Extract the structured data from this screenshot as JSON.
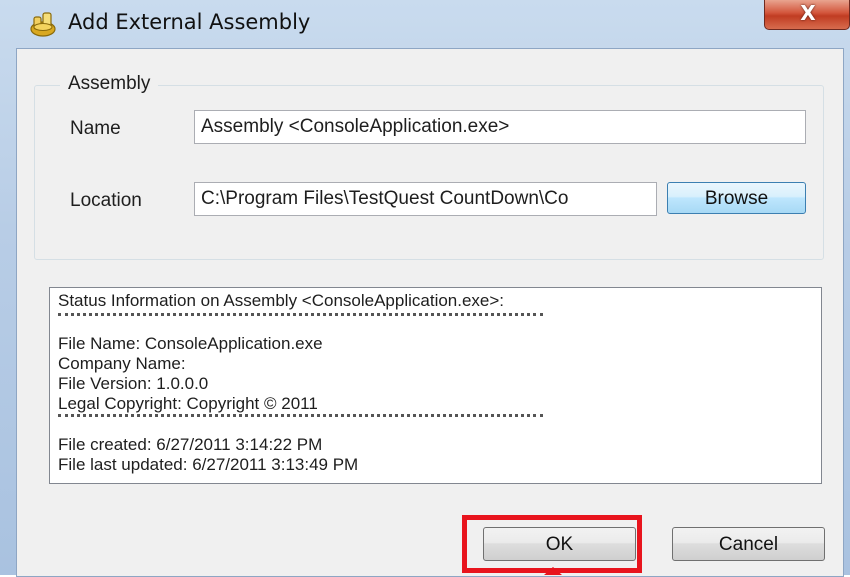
{
  "window": {
    "title": "Add External Assembly",
    "close_glyph": "X"
  },
  "assembly_group": {
    "legend": "Assembly",
    "name_label": "Name",
    "name_value": "Assembly <ConsoleApplication.exe>",
    "location_label": "Location",
    "location_value": "C:\\Program Files\\TestQuest CountDown\\Co",
    "browse_label": "Browse"
  },
  "status": {
    "heading": "Status Information on  Assembly <ConsoleApplication.exe>:",
    "file_name": "File Name: ConsoleApplication.exe",
    "company_name": "Company Name:",
    "file_version": "File Version: 1.0.0.0",
    "legal_copyright": "Legal Copyright: Copyright ©  2011",
    "file_created": "File created: 6/27/2011 3:14:22 PM",
    "file_updated": "File last updated: 6/27/2011 3:13:49 PM"
  },
  "buttons": {
    "ok_label": "OK",
    "cancel_label": "Cancel"
  },
  "annotation": {
    "highlight_color": "#e8141d"
  }
}
